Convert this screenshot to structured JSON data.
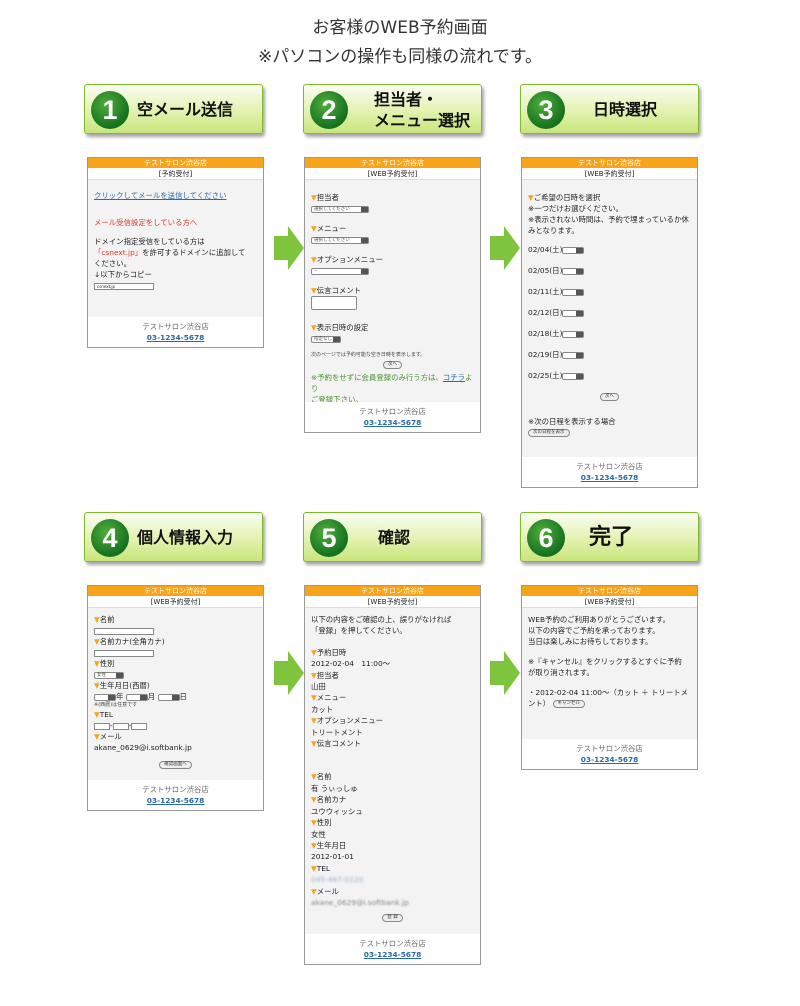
{
  "header": {
    "title": "お客様のWEB予約画面",
    "subtitle": "※パソコンの操作も同様の流れです。"
  },
  "steps": [
    {
      "num": "1",
      "title": "空メール送信"
    },
    {
      "num": "2",
      "title_line1": "担当者・",
      "title_line2": "メニュー選択"
    },
    {
      "num": "3",
      "title": "日時選択"
    },
    {
      "num": "4",
      "title": "個人情報入力"
    },
    {
      "num": "5",
      "title": "確認"
    },
    {
      "num": "6",
      "title": "完了"
    }
  ],
  "common": {
    "shop_name": "テストサロン渋谷店",
    "tel": "03-1234-5678",
    "mark": "▼"
  },
  "screen1": {
    "subtitle": "[予約受付]",
    "link": "クリックしてメールを送信してください",
    "warning": "メール受信設定をしている方へ",
    "text1": "ドメイン指定受信をしている方は",
    "domain": "「csnext.jp」",
    "text2": "を許可するドメインに追加して",
    "text3": "ください。",
    "text4": "↓以下からコピー",
    "copy_value": "csnext.jp"
  },
  "screen2": {
    "subtitle": "[WEB予約受付]",
    "staff_label": "担当者",
    "staff_value": "選択してください",
    "menu_label": "メニュー",
    "menu_value": "選択してください",
    "option_label": "オプションメニュー",
    "option_value": "--",
    "comment_label": "伝言コメント",
    "display_label": "表示日時の設定",
    "display_value": "指定なし",
    "note": "次のページでは予約可能な空き日時を表示します。",
    "next_button": "次へ",
    "member_text1": "※予約をせずに会員登録のみ行う方は、",
    "member_link": "コチラ",
    "member_text2": "より",
    "member_text3": "ご登録下さい。"
  },
  "screen3": {
    "subtitle": "[WEB予約受付]",
    "title": "ご希望の日時を選択",
    "note1": "※一つだけお選びください。",
    "note2": "※表示されない時間は、予約で埋まっているか休みとなります。",
    "dates": [
      "02/04(土)",
      "02/05(日)",
      "02/11(土)",
      "02/12(日)",
      "02/18(土)",
      "02/19(日)",
      "02/25(土)"
    ],
    "next_button": "次へ",
    "more_text": "※次の日程を表示する場合",
    "more_button": "次の日程を表示"
  },
  "screen4": {
    "subtitle": "[WEB予約受付]",
    "name_label": "名前",
    "kana_label": "名前カナ(全角カナ)",
    "gender_label": "性別",
    "gender_value": "女性",
    "birth_label": "生年月日(西暦)",
    "year_label": "年",
    "month_label": "月",
    "day_label": "日",
    "birth_note": "※(西暦)は任意です",
    "tel_label": "TEL",
    "mail_label": "メール",
    "mail_value": "akane_0629@i.softbank.jp",
    "confirm_button": "確認画面へ"
  },
  "screen5": {
    "subtitle": "[WEB予約受付]",
    "intro1": "以下の内容をご確認の上、誤りがなければ",
    "intro2": "「登録」を押してください。",
    "datetime_label": "予約日時",
    "datetime_value": "2012-02-04　11:00～",
    "staff_label": "担当者",
    "staff_value": "山田",
    "menu_label": "メニュー",
    "menu_value": "カット",
    "option_label": "オプションメニュー",
    "option_value": "トリートメント",
    "comment_label": "伝言コメント",
    "name_label": "名前",
    "name_value": "有 うぃっしゅ",
    "kana_label": "名前カナ",
    "kana_value": "ユウウィッシュ",
    "gender_label": "性別",
    "gender_value": "女性",
    "birth_label": "生年月日",
    "birth_value": "2012-01-01",
    "tel_label": "TEL",
    "tel_value": "045-467-0120",
    "mail_label": "メール",
    "mail_value": "akane_0629@i.softbank.jp",
    "register_button": "登 録"
  },
  "screen6": {
    "subtitle": "[WEB予約受付]",
    "text1": "WEB予約のご利用ありがとうございます。",
    "text2": "以下の内容でご予約を承っております。",
    "text3": "当日は楽しみにお待ちしております。",
    "cancel_note1": "※『キャンセル』をクリックするとすぐに予約",
    "cancel_note2": "が取り消されます。",
    "reservation1": "・2012-02-04 11:00～（カット ＋ トリートメ",
    "reservation2": "ント）",
    "cancel_button": "キャンセル"
  },
  "colors": {
    "badge_border": "#7fba2c",
    "circle": "#15701f",
    "arrow": "#7ec53d",
    "phone_header": "#f7a41a",
    "link": "#2b6aa6"
  }
}
